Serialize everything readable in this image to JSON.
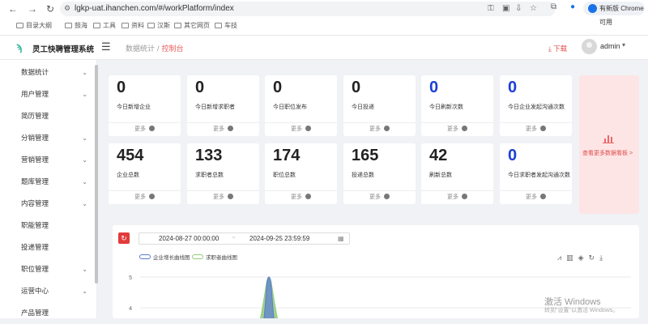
{
  "browser": {
    "url": "lgkp-uat.ihanchen.com/#/workPlatform/index",
    "update_label": "有新版 Chrome 可用",
    "bookmarks": [
      "目录大纲",
      "鼓海",
      "工具",
      "资料",
      "汉斯",
      "其它网页",
      "车技"
    ]
  },
  "header": {
    "app_title": "灵工快聘管理系统",
    "breadcrumb_parent": "数据统计",
    "breadcrumb_sep": "/",
    "breadcrumb_current": "控制台",
    "download_label": "下载",
    "username": "admin"
  },
  "sidebar": {
    "items": [
      {
        "label": "数据统计",
        "has_children": true
      },
      {
        "label": "用户管理",
        "has_children": true
      },
      {
        "label": "简历管理",
        "has_children": false
      },
      {
        "label": "分销管理",
        "has_children": true
      },
      {
        "label": "营销管理",
        "has_children": true
      },
      {
        "label": "题库管理",
        "has_children": true
      },
      {
        "label": "内容管理",
        "has_children": true
      },
      {
        "label": "职能管理",
        "has_children": false
      },
      {
        "label": "投递管理",
        "has_children": false
      },
      {
        "label": "职位管理",
        "has_children": true
      },
      {
        "label": "运营中心",
        "has_children": true
      },
      {
        "label": "产品管理",
        "has_children": false
      }
    ]
  },
  "stats": {
    "more_label": "更多",
    "row1": [
      {
        "value": "0",
        "label": "今日新增企业",
        "blue": false
      },
      {
        "value": "0",
        "label": "今日新增求职者",
        "blue": false
      },
      {
        "value": "0",
        "label": "今日职位发布",
        "blue": false
      },
      {
        "value": "0",
        "label": "今日投递",
        "blue": false
      },
      {
        "value": "0",
        "label": "今日刷新次数",
        "blue": true
      },
      {
        "value": "0",
        "label": "今日企业发起沟通次数",
        "blue": true
      }
    ],
    "row2": [
      {
        "value": "454",
        "label": "企业总数",
        "blue": false
      },
      {
        "value": "133",
        "label": "求职者总数",
        "blue": false
      },
      {
        "value": "174",
        "label": "职位总数",
        "blue": false
      },
      {
        "value": "165",
        "label": "投递总数",
        "blue": false
      },
      {
        "value": "42",
        "label": "刷新总数",
        "blue": false
      },
      {
        "value": "0",
        "label": "今日求职者发起沟通次数",
        "blue": true
      }
    ],
    "dashboard_link": "查看更多数据看板 >"
  },
  "filter": {
    "start": "2024-08-27 00:00:00",
    "sep": "~",
    "end": "2024-09-25 23:59:59"
  },
  "chart_data": {
    "type": "area",
    "series": [
      {
        "name": "企业增长曲线图",
        "color": "#5b7bd5"
      },
      {
        "name": "求职者曲线图",
        "color": "#91cc75"
      }
    ],
    "y_ticks": [
      "5",
      "4"
    ],
    "peak_value": 5
  },
  "os": {
    "watermark": "激活 Windows",
    "watermark_sub": "转到\"设置\"以激活 Windows。"
  }
}
